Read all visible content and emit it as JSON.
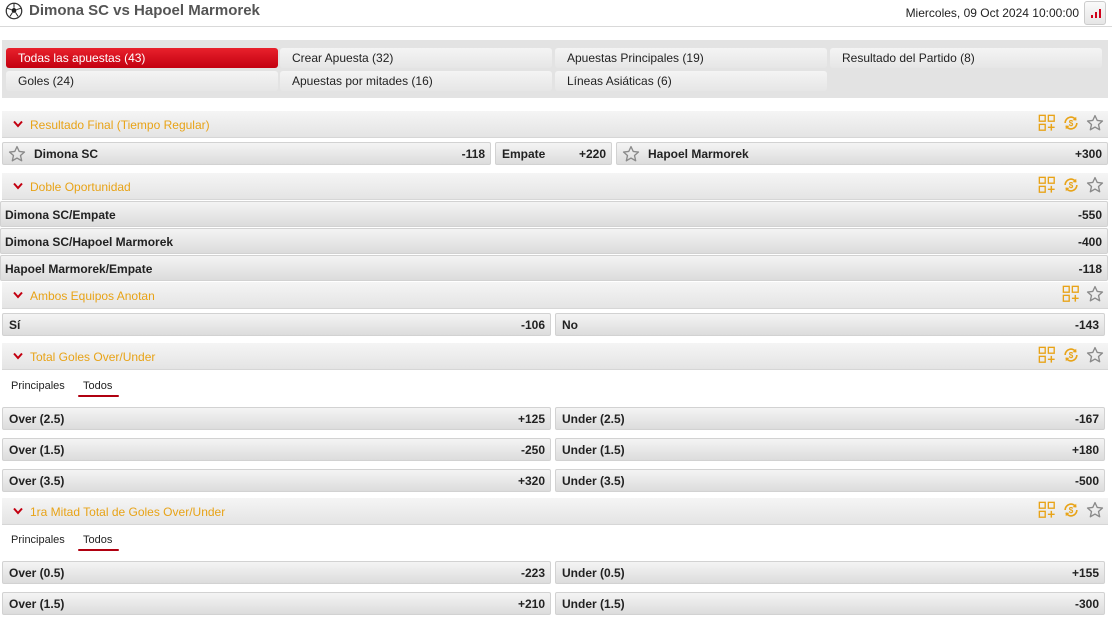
{
  "header": {
    "title": "Dimona SC vs Hapoel Marmorek",
    "datetime": "Miercoles, 09 Oct 2024 10:00:00",
    "icons": [
      "soccer-ball-icon",
      "stats-chart-icon"
    ]
  },
  "tabs": [
    {
      "label": "Todas las apuestas (43)",
      "active": true
    },
    {
      "label": "Crear Apuesta (32)",
      "active": false
    },
    {
      "label": "Apuestas Principales (19)",
      "active": false
    },
    {
      "label": "Resultado del Partido (8)",
      "active": false
    },
    {
      "label": "Goles (24)",
      "active": false
    },
    {
      "label": "Apuestas por mitades (16)",
      "active": false
    },
    {
      "label": "Líneas Asiáticas (6)",
      "active": false
    }
  ],
  "colors": {
    "accent_red": "#c30010",
    "market_title": "#e8a317"
  },
  "markets": {
    "resultado_final": {
      "title": "Resultado Final (Tiempo Regular)",
      "home": {
        "label": "Dimona SC",
        "odds": "-118"
      },
      "draw": {
        "label": "Empate",
        "odds": "+220"
      },
      "away": {
        "label": "Hapoel Marmorek",
        "odds": "+300"
      }
    },
    "doble_oportunidad": {
      "title": "Doble Oportunidad",
      "rows": [
        {
          "label": "Dimona SC/Empate",
          "odds": "-550"
        },
        {
          "label": "Dimona SC/Hapoel Marmorek",
          "odds": "-400"
        },
        {
          "label": "Hapoel Marmorek/Empate",
          "odds": "-118"
        }
      ]
    },
    "ambos_anotan": {
      "title": "Ambos Equipos Anotan",
      "yes": {
        "label": "Sí",
        "odds": "-106"
      },
      "no": {
        "label": "No",
        "odds": "-143"
      }
    },
    "total_goles": {
      "title": "Total Goles Over/Under",
      "subtabs": [
        "Principales",
        "Todos"
      ],
      "active_subtab": "Todos",
      "rows": [
        {
          "over": {
            "label": "Over (2.5)",
            "odds": "+125"
          },
          "under": {
            "label": "Under (2.5)",
            "odds": "-167"
          }
        },
        {
          "over": {
            "label": "Over (1.5)",
            "odds": "-250"
          },
          "under": {
            "label": "Under (1.5)",
            "odds": "+180"
          }
        },
        {
          "over": {
            "label": "Over (3.5)",
            "odds": "+320"
          },
          "under": {
            "label": "Under (3.5)",
            "odds": "-500"
          }
        }
      ]
    },
    "primera_mitad": {
      "title": "1ra Mitad Total de Goles Over/Under",
      "subtabs": [
        "Principales",
        "Todos"
      ],
      "active_subtab": "Todos",
      "rows": [
        {
          "over": {
            "label": "Over (0.5)",
            "odds": "-223"
          },
          "under": {
            "label": "Under (0.5)",
            "odds": "+155"
          }
        },
        {
          "over": {
            "label": "Over (1.5)",
            "odds": "+210"
          },
          "under": {
            "label": "Under (1.5)",
            "odds": "-300"
          }
        }
      ]
    }
  }
}
